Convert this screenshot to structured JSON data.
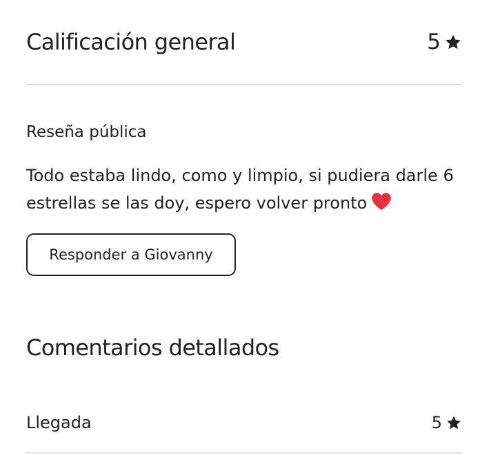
{
  "overall": {
    "title": "Calificación general",
    "rating": "5"
  },
  "public_review": {
    "label": "Reseña pública",
    "text": "Todo estaba lindo, como y limpio, si pudiera darle 6 estrellas se las doy, espero volver pronto",
    "emoji": "red-heart-icon"
  },
  "reply_button": {
    "label": "Responder a Giovanny"
  },
  "detailed": {
    "title": "Comentarios detallados",
    "categories": [
      {
        "label": "Llegada",
        "rating": "5"
      }
    ]
  },
  "colors": {
    "text": "#222222",
    "divider": "#e2e2e2",
    "heart": "#e5323a"
  },
  "icons": [
    "star-icon",
    "heart-icon"
  ]
}
